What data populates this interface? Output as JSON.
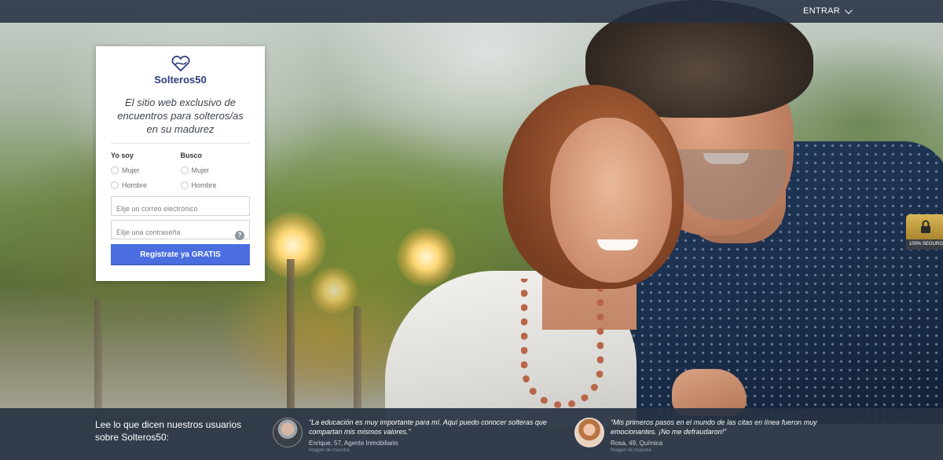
{
  "topbar": {
    "login_label": "ENTRAR"
  },
  "brand": {
    "name": "Solteros50",
    "accent": "#2e3c7e",
    "cta_color": "#4a6de0"
  },
  "card": {
    "tagline": "El sitio web exclusivo de encuentros para solteros/as en su madurez",
    "i_am": {
      "title": "Yo soy",
      "options": [
        "Mujer",
        "Hombre"
      ]
    },
    "seeking": {
      "title": "Busco",
      "options": [
        "Mujer",
        "Hombre"
      ]
    },
    "email_placeholder": "Elije un correo electrónico",
    "password_placeholder": "Elije una contraseña",
    "help_glyph": "?",
    "cta_label": "Registrate ya GRATIS"
  },
  "secure_badge": {
    "label": "100% SEGURO",
    "icon": "lock-icon"
  },
  "testimonials": {
    "heading": "Lee lo que dicen nuestros usuarios  sobre Solteros50:",
    "items": [
      {
        "quote": "“La educación es muy importante para mí. Aquí puedo conocer solteras que compartan mis mismos valores.”",
        "author": "Enrique, 57, Agente Inmobiliario",
        "note": "Imagen de muestra"
      },
      {
        "quote": "“Mis primeros pasos en el mundo de las citas en línea fueron muy emocionantes. ¡No me defraudaron!”",
        "author": "Rosa, 49, Química",
        "note": "Imagen de muestra"
      }
    ]
  }
}
